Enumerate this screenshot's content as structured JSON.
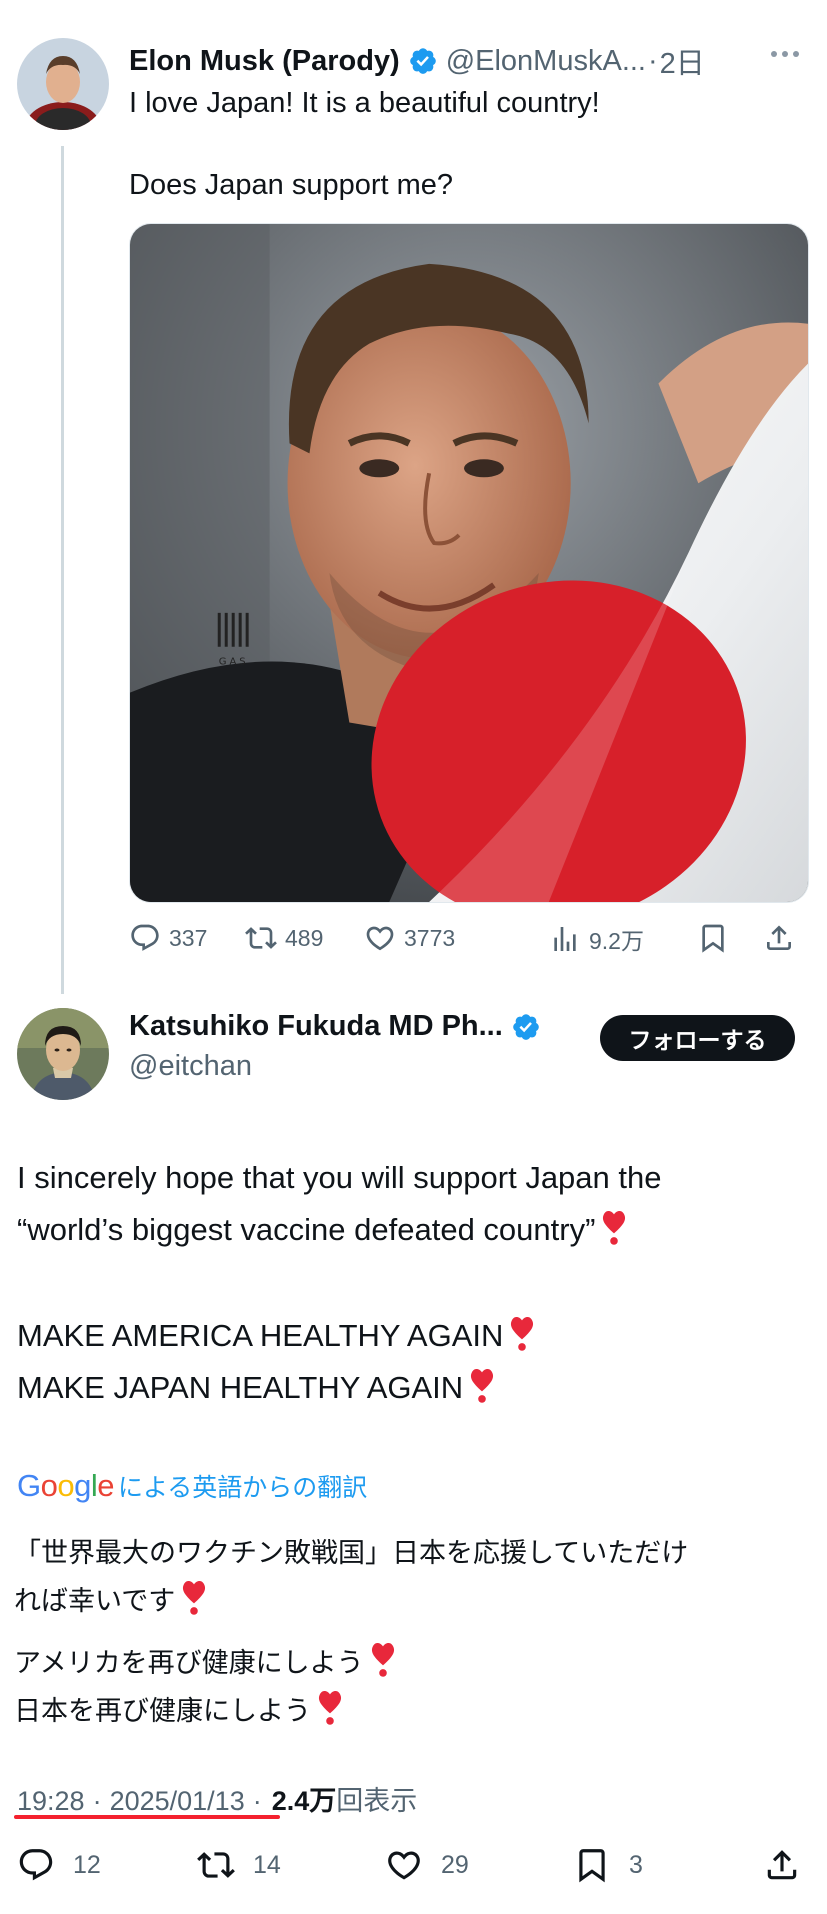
{
  "tweet1": {
    "author_name": "Elon Musk (Parody)",
    "handle": "@ElonMuskA...",
    "separator": "·",
    "time": "2日",
    "paragraphs": [
      "I love Japan! It is a beautiful country!",
      "Does Japan support me?"
    ],
    "media_watermark": "GAS",
    "actions": {
      "replies": "337",
      "retweets": "489",
      "likes": "3773",
      "views": "9.2万"
    }
  },
  "tweet2": {
    "author_name": "Katsuhiko Fukuda MD Ph...",
    "handle": "@eitchan",
    "follow_label": "フォローする",
    "lines_1": [
      "I sincerely hope that you will support Japan the",
      "“world’s biggest vaccine defeated country”"
    ],
    "lines_2": [
      "MAKE AMERICA HEALTHY AGAIN",
      "MAKE JAPAN HEALTHY AGAIN"
    ],
    "translate": {
      "google": "Google",
      "label": "による英語からの翻訳"
    },
    "translated_1": [
      "「世界最大のワクチン敗戦国」日本を応援していただけ",
      "れば幸いです"
    ],
    "translated_2": [
      "アメリカを再び健康にしよう",
      "日本を再び健康にしよう"
    ],
    "meta": {
      "time": "19:28",
      "sep1": "·",
      "date": "2025/01/13",
      "sep2": "·",
      "views_count": "2.4万",
      "views_label": "回表示"
    },
    "actions": {
      "replies": "12",
      "retweets": "14",
      "likes": "29",
      "bookmarks": "3"
    }
  },
  "colors": {
    "verified": "#1d9bf0",
    "secondary_text": "#536471",
    "heart_emoji": "#e8283b",
    "underline": "#f4212e",
    "flag_red": "#d7202a",
    "link_blue": "#1d9bf0"
  },
  "icons": [
    "verified-badge-icon",
    "more-icon",
    "reply-icon",
    "retweet-icon",
    "like-icon",
    "views-icon",
    "bookmark-icon",
    "share-icon",
    "heart-exclamation-icon"
  ]
}
